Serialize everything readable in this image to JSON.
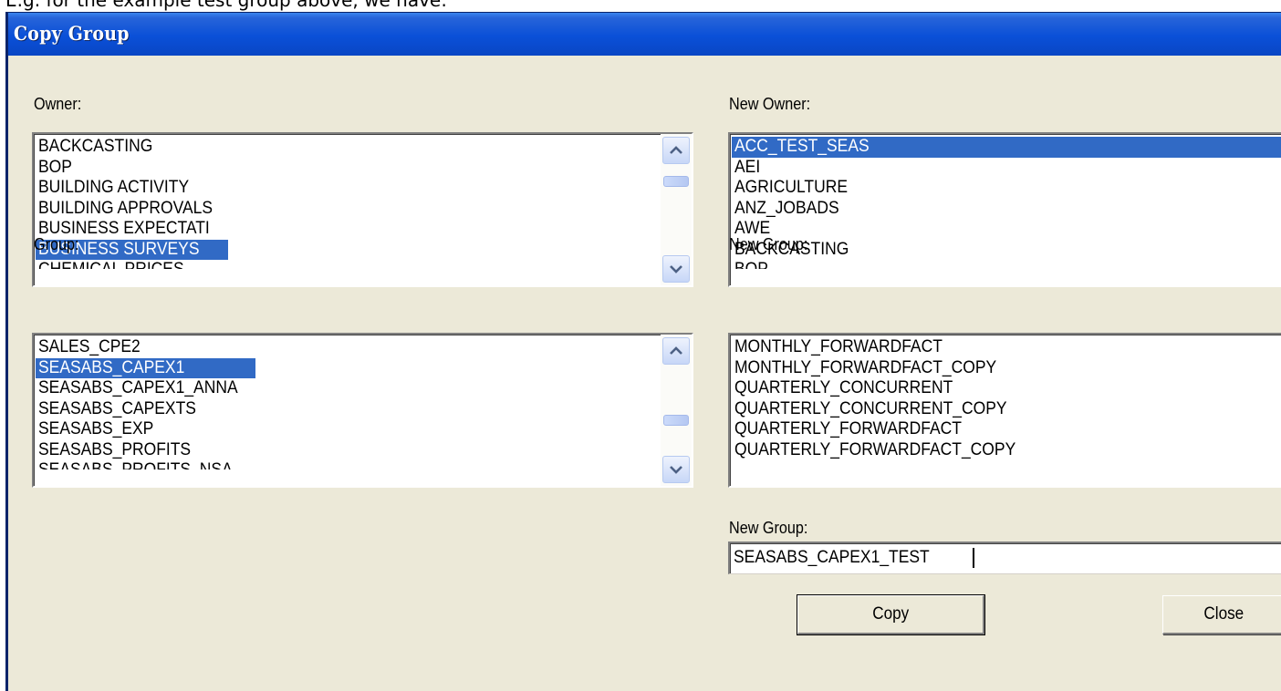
{
  "document": {
    "fragment": "E.g. for the example test group above, we have:"
  },
  "dialog": {
    "title": "Copy Group",
    "owner": {
      "label": "Owner:",
      "items": [
        "BACKCASTING",
        "BOP",
        "BUILDING ACTIVITY",
        "BUILDING APPROVALS",
        "BUSINESS EXPECTATI",
        "BUSINESS SURVEYS",
        "CHEMICAL PRICES"
      ],
      "selected": "BUSINESS SURVEYS"
    },
    "new_owner": {
      "label": "New Owner:",
      "items": [
        "ACC_TEST_SEAS",
        "AEI",
        "AGRICULTURE",
        "ANZ_JOBADS",
        "AWE",
        "BACKCASTING",
        "BOP"
      ],
      "selected": "ACC_TEST_SEAS"
    },
    "group": {
      "label": "Group:",
      "items": [
        "SALES_CPE2",
        "SEASABS_CAPEX1",
        "SEASABS_CAPEX1_ANNA",
        "SEASABS_CAPEXTS",
        "SEASABS_EXP",
        "SEASABS_PROFITS",
        "SEASABS_PROFITS_NSA"
      ],
      "selected": "SEASABS_CAPEX1"
    },
    "new_group_list": {
      "label": "New Group:",
      "items": [
        "MONTHLY_FORWARDFACT",
        "MONTHLY_FORWARDFACT_COPY",
        "QUARTERLY_CONCURRENT",
        "QUARTERLY_CONCURRENT_COPY",
        "QUARTERLY_FORWARDFACT",
        "QUARTERLY_FORWARDFACT_COPY"
      ]
    },
    "new_group_input": {
      "label": "New Group:",
      "value": "SEASABS_CAPEX1_TEST"
    },
    "buttons": {
      "copy": "Copy",
      "close": "Close"
    },
    "colors": {
      "titlebar": "#0a50d8",
      "selection": "#316ac5",
      "face": "#ece9d8"
    },
    "icons": {
      "scroll_up": "chevron-up-icon",
      "scroll_down": "chevron-down-icon"
    }
  }
}
